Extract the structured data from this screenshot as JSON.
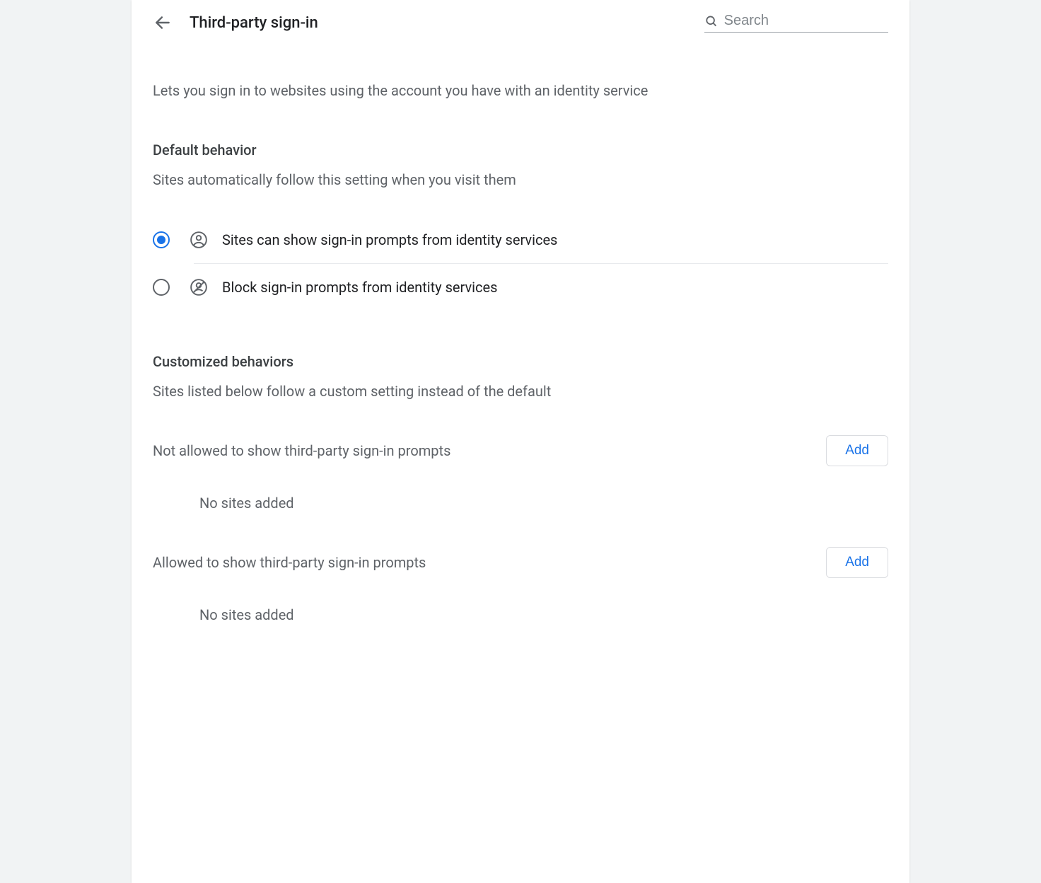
{
  "header": {
    "title": "Third-party sign-in",
    "search_placeholder": "Search"
  },
  "description": "Lets you sign in to websites using the account you have with an identity service",
  "default_behavior": {
    "title": "Default behavior",
    "subtitle": "Sites automatically follow this setting when you visit them",
    "options": [
      {
        "label": "Sites can show sign-in prompts from identity services",
        "selected": true
      },
      {
        "label": "Block sign-in prompts from identity services",
        "selected": false
      }
    ]
  },
  "customized": {
    "title": "Customized behaviors",
    "subtitle": "Sites listed below follow a custom setting instead of the default",
    "sections": [
      {
        "title": "Not allowed to show third-party sign-in prompts",
        "add_label": "Add",
        "empty": "No sites added"
      },
      {
        "title": "Allowed to show third-party sign-in prompts",
        "add_label": "Add",
        "empty": "No sites added"
      }
    ]
  }
}
